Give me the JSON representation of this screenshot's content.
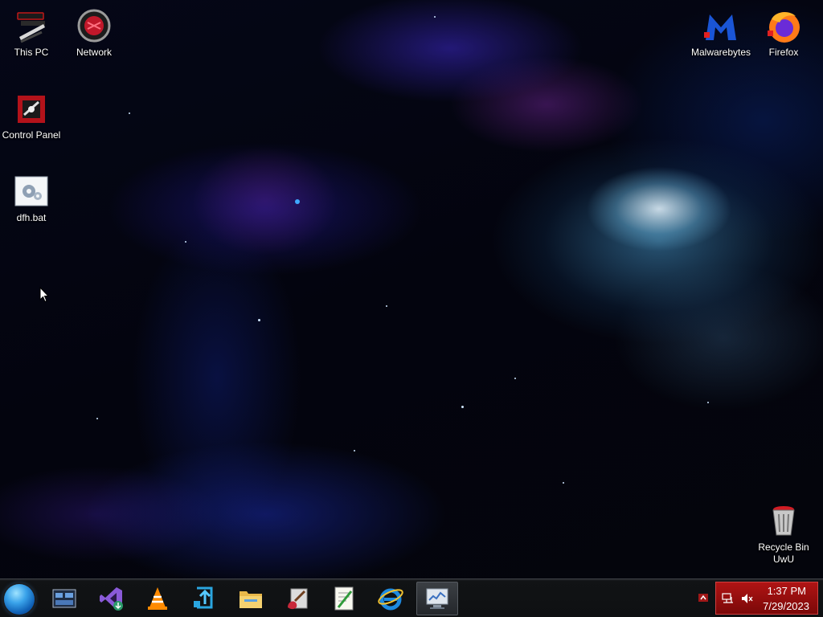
{
  "desktop": {
    "icons": [
      {
        "label": "This PC"
      },
      {
        "label": "Network"
      },
      {
        "label": "Control Panel"
      },
      {
        "label": "dfh.bat"
      },
      {
        "label": "Malwarebytes"
      },
      {
        "label": "Firefox"
      },
      {
        "label": "Recycle Bin\nUwU"
      }
    ]
  },
  "taskbar": {
    "pinned": [
      {
        "icon": "task-view-icon"
      },
      {
        "icon": "visual-studio-icon"
      },
      {
        "icon": "vlc-icon"
      },
      {
        "icon": "blue-app-icon"
      },
      {
        "icon": "file-explorer-icon"
      },
      {
        "icon": "paint-icon"
      },
      {
        "icon": "notepad-icon"
      },
      {
        "icon": "internet-explorer-icon"
      },
      {
        "icon": "performance-monitor-icon"
      }
    ],
    "tray": {
      "time": "1:37 PM",
      "date": "7/29/2023",
      "accent": "#a50f0f"
    }
  }
}
